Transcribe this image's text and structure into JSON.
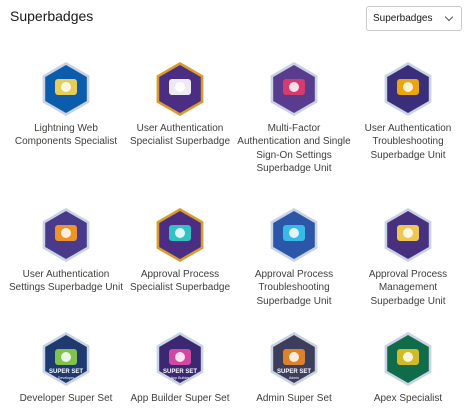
{
  "header": {
    "title": "Superbadges"
  },
  "filter": {
    "selected": "Superbadges"
  },
  "badges": [
    {
      "label": "Lightning Web Components Specialist",
      "icon": "lightning-web-components-badge-icon",
      "bg": "#0b5cab",
      "border": "#c9d3e3",
      "glyph": "#ffd84d"
    },
    {
      "label": "User Authentication Specialist Superbadge",
      "icon": "user-authentication-badge-icon",
      "bg": "#4b2e83",
      "border": "#d99c2b",
      "glyph": "#ffffff"
    },
    {
      "label": "Multi-Factor Authentication and Single Sign-On Settings Superbadge Unit",
      "icon": "mfa-sso-badge-icon",
      "bg": "#5a3c8f",
      "border": "#c9d3e3",
      "glyph": "#e23b6a"
    },
    {
      "label": "User Authentication Troubleshooting Superbadge Unit",
      "icon": "user-auth-troubleshooting-badge-icon",
      "bg": "#3a2d7a",
      "border": "#c9d3e3",
      "glyph": "#ffb400"
    },
    {
      "label": "User Authentication Settings Superbadge Unit",
      "icon": "user-auth-settings-badge-icon",
      "bg": "#4a3a8c",
      "border": "#c9d3e3",
      "glyph": "#ff9f1c"
    },
    {
      "label": "Approval Process Specialist Superbadge",
      "icon": "approval-process-badge-icon",
      "bg": "#4b2e83",
      "border": "#d99c2b",
      "glyph": "#2fd3c9"
    },
    {
      "label": "Approval Process Troubleshooting Superbadge Unit",
      "icon": "approval-troubleshooting-badge-icon",
      "bg": "#2c57a8",
      "border": "#c9d3e3",
      "glyph": "#39c4f0"
    },
    {
      "label": "Approval Process Management Superbadge Unit",
      "icon": "approval-management-badge-icon",
      "bg": "#47307d",
      "border": "#c9d3e3",
      "glyph": "#ffd84d"
    },
    {
      "label": "Developer Super Set",
      "icon": "developer-super-set-badge-icon",
      "bg": "#1e3a6e",
      "border": "#c9d3e3",
      "glyph": "#8bd147",
      "caption": "SUPER SET",
      "sub": "Developer"
    },
    {
      "label": "App Builder Super Set",
      "icon": "app-builder-super-set-badge-icon",
      "bg": "#3b2872",
      "border": "#c9d3e3",
      "glyph": "#e24aa6",
      "caption": "SUPER SET",
      "sub": "App Builder"
    },
    {
      "label": "Admin Super Set",
      "icon": "admin-super-set-badge-icon",
      "bg": "#3d3d5c",
      "border": "#c9d3e3",
      "glyph": "#f08a24",
      "caption": "SUPER SET",
      "sub": "Admin"
    },
    {
      "label": "Apex Specialist",
      "icon": "apex-specialist-badge-icon",
      "bg": "#0f6b4a",
      "border": "#c9d3e3",
      "glyph": "#e6c422"
    }
  ]
}
